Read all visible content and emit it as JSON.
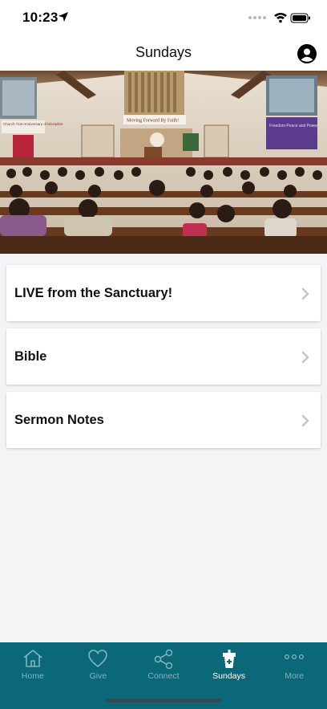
{
  "status_bar": {
    "time": "10:23"
  },
  "nav": {
    "title": "Sundays"
  },
  "hero": {
    "banner_text": "Moving Forward By Faith!",
    "left_banner_text": "Church 71st Anniversary of Discipline",
    "right_banner_text": "Freedom Peace and Power"
  },
  "menu": {
    "items": [
      {
        "label": "LIVE from the Sanctuary!"
      },
      {
        "label": "Bible"
      },
      {
        "label": "Sermon Notes"
      }
    ]
  },
  "tab_bar": {
    "tabs": [
      {
        "label": "Home",
        "icon": "home-icon"
      },
      {
        "label": "Give",
        "icon": "heart-icon"
      },
      {
        "label": "Connect",
        "icon": "share-icon"
      },
      {
        "label": "Sundays",
        "icon": "pulpit-icon",
        "active": true
      },
      {
        "label": "More",
        "icon": "more-icon"
      }
    ]
  },
  "colors": {
    "tab_bar_bg": "#0b6878",
    "tab_inactive": "#7fb6c0",
    "tab_active": "#ffffff",
    "background": "#f4f4f6"
  }
}
